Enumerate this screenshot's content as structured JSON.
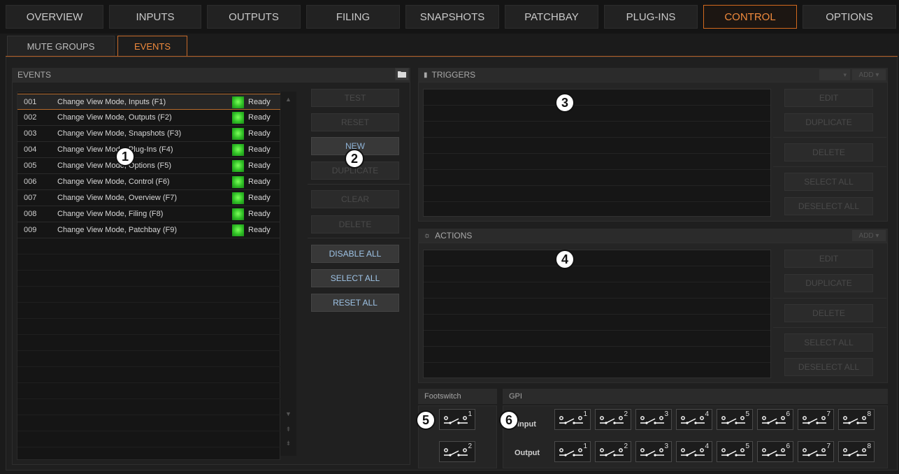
{
  "nav": {
    "tabs": [
      "OVERVIEW",
      "INPUTS",
      "OUTPUTS",
      "FILING",
      "SNAPSHOTS",
      "PATCHBAY",
      "PLUG-INS",
      "CONTROL",
      "OPTIONS"
    ],
    "active": "CONTROL"
  },
  "subtabs": [
    "MUTE GROUPS",
    "EVENTS"
  ],
  "events": {
    "title": "EVENTS",
    "rows": [
      {
        "num": "001",
        "name": "Change View Mode, Inputs (F1)",
        "status": "Ready"
      },
      {
        "num": "002",
        "name": "Change View Mode, Outputs (F2)",
        "status": "Ready"
      },
      {
        "num": "003",
        "name": "Change View Mode, Snapshots (F3)",
        "status": "Ready"
      },
      {
        "num": "004",
        "name": "Change View Mode, Plug-Ins (F4)",
        "status": "Ready"
      },
      {
        "num": "005",
        "name": "Change View Mode, Options (F5)",
        "status": "Ready"
      },
      {
        "num": "006",
        "name": "Change View Mode, Control (F6)",
        "status": "Ready"
      },
      {
        "num": "007",
        "name": "Change View Mode, Overview (F7)",
        "status": "Ready"
      },
      {
        "num": "008",
        "name": "Change View Mode, Filing (F8)",
        "status": "Ready"
      },
      {
        "num": "009",
        "name": "Change View Mode, Patchbay (F9)",
        "status": "Ready"
      }
    ],
    "buttons": {
      "test": "TEST",
      "reset": "RESET",
      "new": "NEW",
      "duplicate": "DUPLICATE",
      "clear": "CLEAR",
      "delete": "DELETE",
      "disable_all": "DISABLE ALL",
      "select_all": "SELECT ALL",
      "reset_all": "RESET ALL"
    }
  },
  "triggers": {
    "title": "TRIGGERS",
    "add": "ADD",
    "buttons": {
      "edit": "EDIT",
      "duplicate": "DUPLICATE",
      "delete": "DELETE",
      "select_all": "SELECT ALL",
      "deselect_all": "DESELECT ALL"
    }
  },
  "actions": {
    "title": "ACTIONS",
    "add": "ADD",
    "buttons": {
      "edit": "EDIT",
      "duplicate": "DUPLICATE",
      "delete": "DELETE",
      "select_all": "SELECT ALL",
      "deselect_all": "DESELECT ALL"
    }
  },
  "footswitch": {
    "title": "Footswitch",
    "switches": [
      "1",
      "2"
    ]
  },
  "gpi": {
    "title": "GPI",
    "input_label": "Input",
    "output_label": "Output",
    "inputs": [
      "1",
      "2",
      "3",
      "4",
      "5",
      "6",
      "7",
      "8"
    ],
    "outputs": [
      "1",
      "2",
      "3",
      "4",
      "5",
      "6",
      "7",
      "8"
    ]
  },
  "callouts": [
    "1",
    "2",
    "3",
    "4",
    "5",
    "6"
  ],
  "colors": {
    "accent": "#f08a3c",
    "active_button_text": "#8fb4d8",
    "ready_led": "#3fd02e"
  }
}
